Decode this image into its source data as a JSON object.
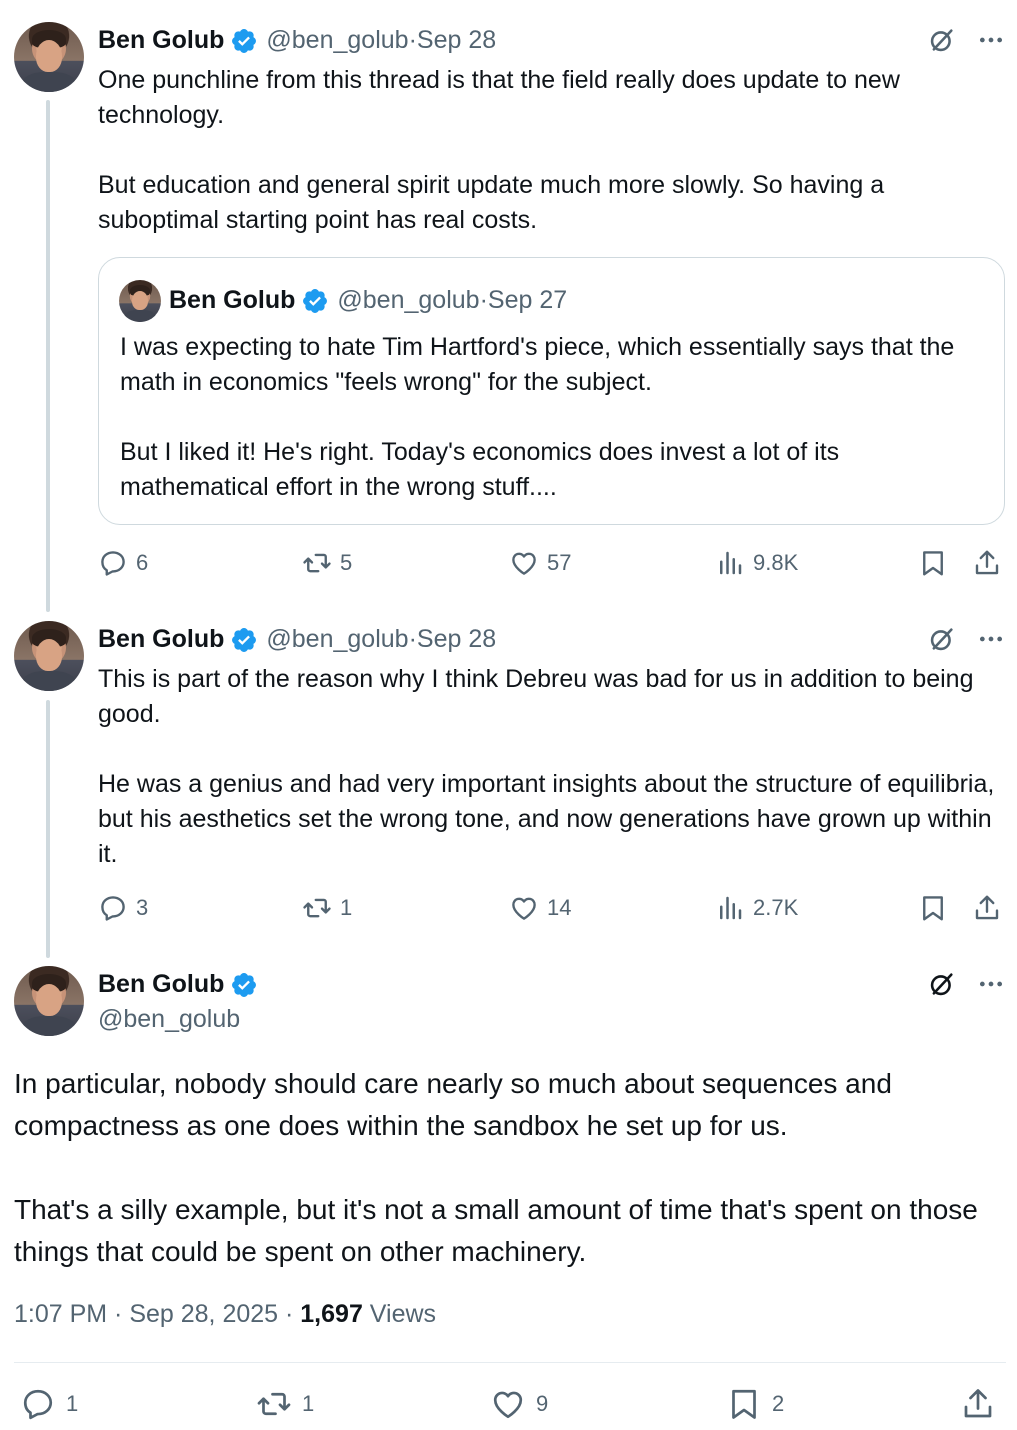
{
  "tweets": [
    {
      "author_name": "Ben Golub",
      "handle": "@ben_golub",
      "date": "Sep 28",
      "text": "One punchline from this thread is that the field really does update to new technology.\n\nBut education and general spirit update much more slowly. So having a suboptimal starting point has real costs.",
      "quote": {
        "author_name": "Ben Golub",
        "handle": "@ben_golub",
        "date": "Sep 27",
        "text": "I was expecting to hate Tim Hartford's piece, which essentially says that the math in economics \"feels wrong\" for the subject.\n\nBut I liked it! He's right. Today's economics does invest a lot of its mathematical effort in the wrong stuff...."
      },
      "replies": "6",
      "reposts": "5",
      "likes": "57",
      "views": "9.8K"
    },
    {
      "author_name": "Ben Golub",
      "handle": "@ben_golub",
      "date": "Sep 28",
      "text": "This is part of the reason why I think Debreu was bad for us in addition to being good.\n\nHe was a genius and had very important insights about the structure of equilibria, but his aesthetics set the wrong tone, and now generations have grown up within it.",
      "replies": "3",
      "reposts": "1",
      "likes": "14",
      "views": "2.7K"
    }
  ],
  "main_tweet": {
    "author_name": "Ben Golub",
    "handle": "@ben_golub",
    "text": "In particular, nobody should care nearly so much about sequences and compactness as one does within the sandbox he set up for us.\n\nThat's a silly example, but it's not a small amount of time that's spent on those things that could be spent on other machinery.",
    "timestamp": "1:07 PM · Sep 28, 2025 · ",
    "views_count": "1,697",
    "views_label": " Views",
    "replies": "1",
    "reposts": "1",
    "likes": "9",
    "bookmarks": "2"
  },
  "separator": " · ",
  "colors": {
    "verified_badge": "#1d9bf0",
    "text_primary": "#0f1419",
    "text_secondary": "#536471",
    "thread_line": "#cfd9de"
  },
  "icons": [
    "verified-badge-icon",
    "grok-icon",
    "more-icon",
    "reply-icon",
    "repost-icon",
    "like-icon",
    "views-icon",
    "bookmark-icon",
    "share-icon"
  ]
}
